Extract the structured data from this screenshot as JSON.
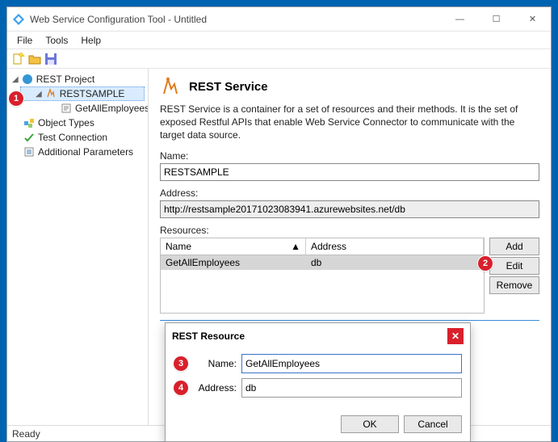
{
  "window": {
    "title": "Web Service Configuration Tool - Untitled",
    "min_tip": "—",
    "max_tip": "☐",
    "close_tip": "✕"
  },
  "menu": {
    "file": "File",
    "tools": "Tools",
    "help": "Help"
  },
  "tree": {
    "root": "REST Project",
    "service": "RESTSAMPLE",
    "resource": "GetAllEmployees",
    "objectTypes": "Object Types",
    "testConn": "Test Connection",
    "addParams": "Additional Parameters"
  },
  "content": {
    "heading": "REST Service",
    "desc": "REST Service is a container for a set of resources and their methods. It is the set of exposed Restful APIs that enable Web Service Connector to communicate with the target data source.",
    "nameLabel": "Name:",
    "nameValue": "RESTSAMPLE",
    "addressLabel": "Address:",
    "addressValue": "http://restsample20171023083941.azurewebsites.net/db",
    "resourcesLabel": "Resources:",
    "colName": "Name",
    "colAddress": "Address",
    "row": {
      "name": "GetAllEmployees",
      "address": "db"
    },
    "btnAdd": "Add",
    "btnEdit": "Edit",
    "btnRemove": "Remove"
  },
  "dialog": {
    "title": "REST Resource",
    "nameLabel": "Name:",
    "nameValue": "GetAllEmployees",
    "addressLabel": "Address:",
    "addressValue": "db",
    "ok": "OK",
    "cancel": "Cancel"
  },
  "status": {
    "text": "Ready"
  },
  "callouts": {
    "c1": "1",
    "c2": "2",
    "c3": "3",
    "c4": "4"
  }
}
